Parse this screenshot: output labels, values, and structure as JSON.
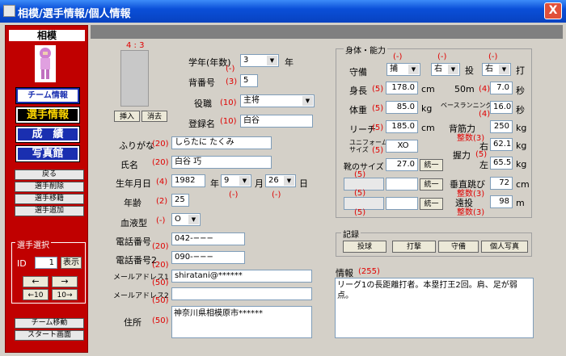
{
  "window": {
    "title": "相模/選手情報/個人情報",
    "close": "X"
  },
  "sidebar": {
    "team": "相模",
    "nav": [
      "チーム情報",
      "選手情報",
      "成　績",
      "写真館"
    ],
    "buttons": [
      "戻る",
      "選手削除",
      "選手移籍",
      "選手追加"
    ],
    "select_group": "選手選択",
    "id_label": "ID",
    "id_value": "1",
    "show": "表示",
    "prev": "←",
    "next": "→",
    "prev10": "←10",
    "next10": "10→",
    "bottom": [
      "チーム移動",
      "スタート画面"
    ]
  },
  "photo": {
    "ratio": "4 : 3",
    "insert": "挿入",
    "delete": "消去"
  },
  "form": {
    "grade_label": "学年(年数)",
    "grade_value": "3",
    "grade_unit": "年",
    "grade_hint": "(-)",
    "number_label": "背番号",
    "number_limit": "(3)",
    "number_value": "5",
    "role_label": "役職",
    "role_limit": "(10)",
    "role_value": "主将",
    "regname_label": "登録名",
    "regname_limit": "(10)",
    "regname_value": "白谷",
    "kana_label": "ふりがな",
    "kana_limit": "(20)",
    "kana_value": "しらたに たくみ",
    "name_label": "氏名",
    "name_limit": "(20)",
    "name_value": "白谷 巧",
    "birth_label": "生年月日",
    "birth_limit": "(4)",
    "birth_year": "1982",
    "birth_year_unit": "年",
    "birth_month": "9",
    "birth_month_unit": "月",
    "birth_day": "26",
    "birth_day_unit": "日",
    "birth_month_hint": "(-)",
    "birth_day_hint": "(-)",
    "age_label": "年齢",
    "age_limit": "(2)",
    "age_value": "25",
    "blood_label": "血液型",
    "blood_limit": "(-)",
    "blood_value": "O",
    "tel1_label": "電話番号",
    "tel1_limit": "(20)",
    "tel1_value": "042-−−−",
    "tel2_label": "電話番号2",
    "tel2_limit": "(20)",
    "tel2_value": "090-−−−",
    "mail1_label": "メールアドレス1",
    "mail1_limit": "(50)",
    "mail1_value": "shiratani@******",
    "mail2_label": "メールアドレス2",
    "mail2_limit": "(50)",
    "mail2_value": "",
    "addr_label": "住所",
    "addr_limit": "(50)",
    "addr_value": "神奈川県相模原市******"
  },
  "ability": {
    "title": "身体・能力",
    "pos_label": "守備",
    "pos_value": "捕",
    "throw_value": "右",
    "throw_unit": "投",
    "bat_value": "右",
    "bat_unit": "打",
    "hint": "(-)",
    "height_label": "身長",
    "height_limit": "(5)",
    "height_value": "178.0",
    "height_unit": "cm",
    "weight_label": "体重",
    "weight_limit": "(5)",
    "weight_value": "85.0",
    "weight_unit": "kg",
    "reach_label": "リーチ",
    "reach_limit": "(5)",
    "reach_value": "185.0",
    "reach_unit": "cm",
    "uniform_label": "ユニフォーム\nサイズ",
    "uniform_limit": "(5)",
    "uniform_value": "XO",
    "shoe_label": "靴のサイズ",
    "shoe_limit": "(5)",
    "shoe_value": "27.0",
    "shoe_unit": "cm",
    "extra_limit": "(5)",
    "unify": "統一",
    "run50_label": "50m",
    "run50_limit": "(4)",
    "run50_value": "7.0",
    "run50_unit": "秒",
    "base_label": "ベースランニング",
    "base_limit": "(4)",
    "base_value": "16.0",
    "base_unit": "秒",
    "muscle_label": "背筋力",
    "muscle_limit": "整数(3)",
    "muscle_value": "250",
    "muscle_unit": "kg",
    "grip_label": "握力",
    "grip_limit": "(5)",
    "grip_right": "右",
    "grip_right_value": "62.1",
    "grip_left": "左",
    "grip_left_value": "65.5",
    "grip_unit": "kg",
    "jump_label": "垂直跳び",
    "jump_limit": "整数(3)",
    "jump_value": "72",
    "jump_unit": "cm",
    "throwdist_label": "遠投",
    "throwdist_limit": "整数(3)",
    "throwdist_value": "98",
    "throwdist_unit": "m"
  },
  "record": {
    "title": "記録",
    "buttons": [
      "投球",
      "打撃",
      "守備",
      "個人写真"
    ]
  },
  "info": {
    "title": "情報",
    "limit": "(255)",
    "text": "リーグ1の長距離打者。本塁打王2回。肩、足が弱点。"
  }
}
